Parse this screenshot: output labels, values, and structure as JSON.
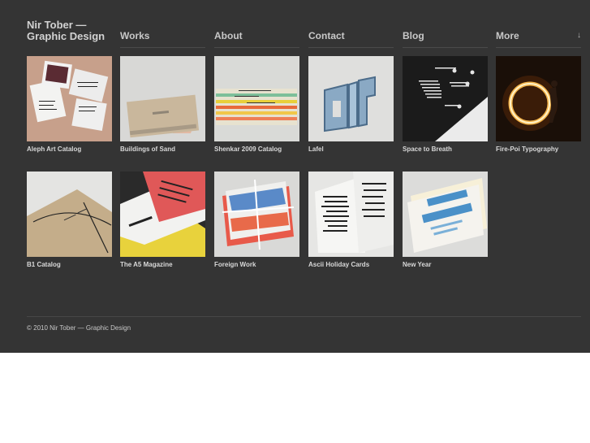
{
  "site": {
    "title_line1": "Nir Tober —",
    "title_line2": "Graphic Design"
  },
  "nav": {
    "works": "Works",
    "about": "About",
    "contact": "Contact",
    "blog": "Blog",
    "more": "More",
    "more_icon": "arrow-down-icon"
  },
  "works": [
    {
      "caption": "Aleph Art Catalog"
    },
    {
      "caption": "Buildings of Sand"
    },
    {
      "caption": "Shenkar 2009 Catalog"
    },
    {
      "caption": "Lafel"
    },
    {
      "caption": "Space to Breath"
    },
    {
      "caption": "Fire-Poi Typography"
    },
    {
      "caption": "B1 Catalog"
    },
    {
      "caption": "The A5 Magazine"
    },
    {
      "caption": "Foreign Work"
    },
    {
      "caption": "Ascii Holiday Cards"
    },
    {
      "caption": "New Year"
    }
  ],
  "footer": {
    "text": "© 2010 Nir Tober — Graphic Design"
  },
  "colors": {
    "background": "#343434",
    "text": "#d2d2d2",
    "rule": "#4a4a4a"
  }
}
